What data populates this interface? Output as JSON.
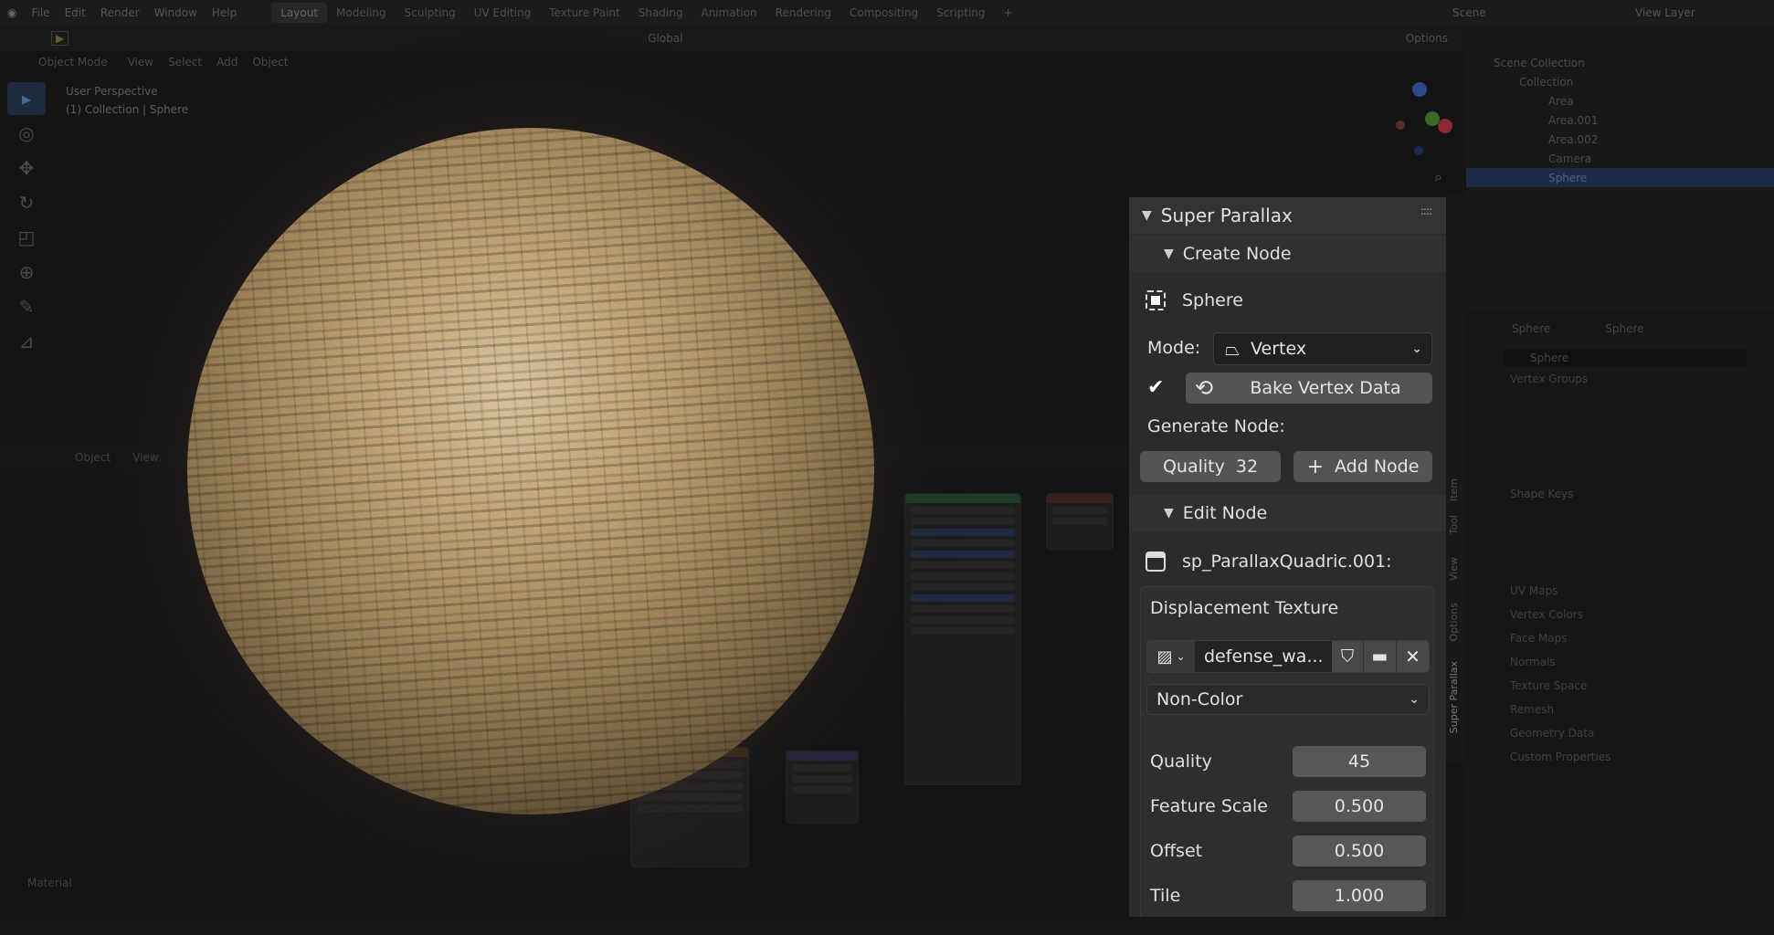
{
  "menu": {
    "items": [
      "File",
      "Edit",
      "Render",
      "Window",
      "Help"
    ]
  },
  "workspaces": [
    "Layout",
    "Modeling",
    "Sculpting",
    "UV Editing",
    "Texture Paint",
    "Shading",
    "Animation",
    "Rendering",
    "Compositing",
    "Scripting"
  ],
  "scene": {
    "name": "Scene",
    "view_layer": "View Layer"
  },
  "viewport_header": {
    "mode": "Object Mode",
    "menus": [
      "View",
      "Select",
      "Add",
      "Object"
    ],
    "transform": "Global",
    "options": "Options"
  },
  "viewport": {
    "perspective": "User Perspective",
    "collection": "(1) Collection | Sphere"
  },
  "node_editor": {
    "mode": "Object",
    "view": "View",
    "footer": "Material"
  },
  "outliner": {
    "root": "Scene Collection",
    "collection": "Collection",
    "items": [
      "Area",
      "Area.001",
      "Area.002",
      "Camera",
      "Sphere"
    ]
  },
  "properties": {
    "object": "Sphere",
    "mesh": "Sphere",
    "mesh_field": "Sphere",
    "sections": [
      "Vertex Groups",
      "Shape Keys",
      "UV Maps",
      "Vertex Colors",
      "Face Maps",
      "Normals",
      "Texture Space",
      "Remesh",
      "Geometry Data",
      "Custom Properties"
    ]
  },
  "n_tabs": [
    "Item",
    "Tool",
    "View",
    "Options",
    "Super Parallax"
  ],
  "panel": {
    "title": "Super Parallax",
    "create_node": {
      "title": "Create Node",
      "object": "Sphere",
      "mode_label": "Mode:",
      "mode_value": "Vertex",
      "bake_label": "Bake Vertex Data",
      "generate_label": "Generate Node:",
      "quality_label": "Quality",
      "quality_value": "32",
      "add_node_label": "Add Node"
    },
    "edit_node": {
      "title": "Edit Node",
      "node_name": "sp_ParallaxQuadric.001:",
      "displacement_title": "Displacement Texture",
      "image_name": "defense_wa...",
      "color_space": "Non-Color",
      "params": [
        {
          "label": "Quality",
          "value": "45"
        },
        {
          "label": "Feature Scale",
          "value": "0.500"
        },
        {
          "label": "Offset",
          "value": "0.500"
        },
        {
          "label": "Tile",
          "value": "1.000"
        }
      ]
    }
  },
  "icons": [
    "blender-icon",
    "render-play-icon",
    "sphere-object-icon",
    "vertex-mode-icon",
    "check-icon",
    "refresh-icon",
    "plus-icon",
    "node-icon",
    "image-icon",
    "shield-icon",
    "folder-icon",
    "close-icon",
    "chevron-down-icon",
    "grip-icon"
  ]
}
